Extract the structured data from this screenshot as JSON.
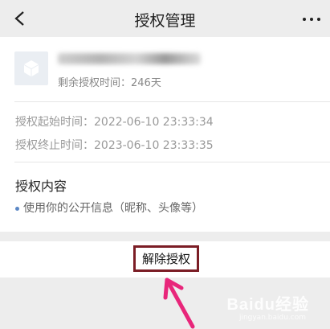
{
  "header": {
    "title": "授权管理",
    "back_icon": "back-arrow-icon",
    "more_icon": "more-dots-icon"
  },
  "app": {
    "remaining_label": "剩余授权时间：246天",
    "icon": "cube-icon"
  },
  "times": {
    "start": "授权起始时间：2022-06-10 23:33:34",
    "end": "授权终止时间：2023-06-10 23:33:35"
  },
  "content": {
    "title": "授权内容",
    "items": [
      "使用你的公开信息（昵称、头像等）"
    ]
  },
  "actions": {
    "revoke_label": "解除授权"
  },
  "annotation": {
    "highlight_color": "#7b1d25",
    "arrow_color": "#e8267a"
  },
  "watermark": {
    "text": "Baidu经验",
    "sub": "jingyan.baidu.com"
  }
}
